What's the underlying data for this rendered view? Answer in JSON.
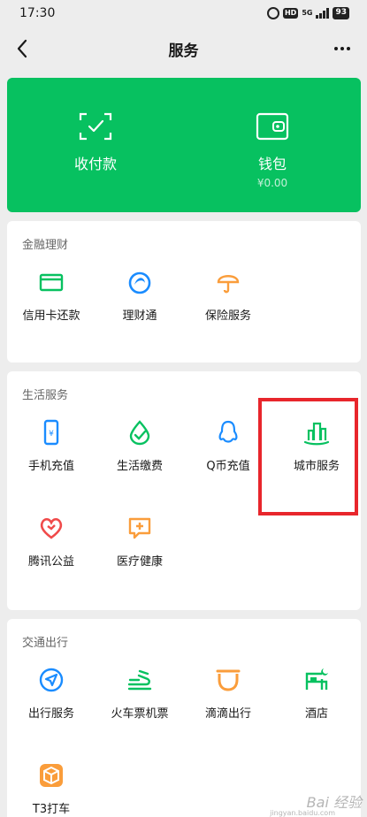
{
  "status_bar": {
    "time": "17:30",
    "battery": "93",
    "network": "5G"
  },
  "nav": {
    "title": "服务"
  },
  "wallet_card": {
    "pay_label": "收付款",
    "wallet_label": "钱包",
    "wallet_balance": "¥0.00"
  },
  "sections": {
    "finance": {
      "title": "金融理财",
      "items": [
        {
          "label": "信用卡还款",
          "icon": "credit-card-icon"
        },
        {
          "label": "理财通",
          "icon": "wealth-icon"
        },
        {
          "label": "保险服务",
          "icon": "umbrella-icon"
        }
      ]
    },
    "life": {
      "title": "生活服务",
      "items": [
        {
          "label": "手机充值",
          "icon": "phone-icon"
        },
        {
          "label": "生活缴费",
          "icon": "bill-icon"
        },
        {
          "label": "Q币充值",
          "icon": "penguin-icon"
        },
        {
          "label": "城市服务",
          "icon": "city-icon"
        },
        {
          "label": "腾讯公益",
          "icon": "heart-icon"
        },
        {
          "label": "医疗健康",
          "icon": "medical-icon"
        }
      ]
    },
    "travel": {
      "title": "交通出行",
      "items": [
        {
          "label": "出行服务",
          "icon": "navigation-icon"
        },
        {
          "label": "火车票机票",
          "icon": "train-icon"
        },
        {
          "label": "滴滴出行",
          "icon": "didi-icon"
        },
        {
          "label": "酒店",
          "icon": "hotel-icon"
        },
        {
          "label": "T3打车",
          "icon": "t3-icon"
        }
      ]
    }
  },
  "watermark": {
    "text": "Bai 经验",
    "sub": "jingyan.baidu.com"
  },
  "colors": {
    "brand_green": "#07c160",
    "highlight_red": "#e8262c",
    "blue": "#1a8cff",
    "orange": "#fa9d3b",
    "red": "#f04a4a"
  }
}
